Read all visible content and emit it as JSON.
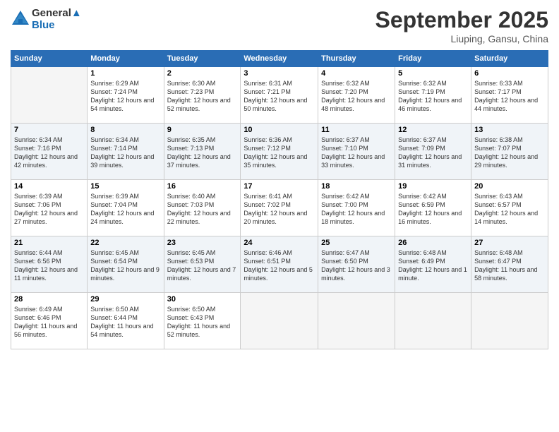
{
  "header": {
    "logo_line1": "General",
    "logo_line2": "Blue",
    "month": "September 2025",
    "location": "Liuping, Gansu, China"
  },
  "weekdays": [
    "Sunday",
    "Monday",
    "Tuesday",
    "Wednesday",
    "Thursday",
    "Friday",
    "Saturday"
  ],
  "weeks": [
    [
      {
        "day": "",
        "sunrise": "",
        "sunset": "",
        "daylight": ""
      },
      {
        "day": "1",
        "sunrise": "Sunrise: 6:29 AM",
        "sunset": "Sunset: 7:24 PM",
        "daylight": "Daylight: 12 hours and 54 minutes."
      },
      {
        "day": "2",
        "sunrise": "Sunrise: 6:30 AM",
        "sunset": "Sunset: 7:23 PM",
        "daylight": "Daylight: 12 hours and 52 minutes."
      },
      {
        "day": "3",
        "sunrise": "Sunrise: 6:31 AM",
        "sunset": "Sunset: 7:21 PM",
        "daylight": "Daylight: 12 hours and 50 minutes."
      },
      {
        "day": "4",
        "sunrise": "Sunrise: 6:32 AM",
        "sunset": "Sunset: 7:20 PM",
        "daylight": "Daylight: 12 hours and 48 minutes."
      },
      {
        "day": "5",
        "sunrise": "Sunrise: 6:32 AM",
        "sunset": "Sunset: 7:19 PM",
        "daylight": "Daylight: 12 hours and 46 minutes."
      },
      {
        "day": "6",
        "sunrise": "Sunrise: 6:33 AM",
        "sunset": "Sunset: 7:17 PM",
        "daylight": "Daylight: 12 hours and 44 minutes."
      }
    ],
    [
      {
        "day": "7",
        "sunrise": "Sunrise: 6:34 AM",
        "sunset": "Sunset: 7:16 PM",
        "daylight": "Daylight: 12 hours and 42 minutes."
      },
      {
        "day": "8",
        "sunrise": "Sunrise: 6:34 AM",
        "sunset": "Sunset: 7:14 PM",
        "daylight": "Daylight: 12 hours and 39 minutes."
      },
      {
        "day": "9",
        "sunrise": "Sunrise: 6:35 AM",
        "sunset": "Sunset: 7:13 PM",
        "daylight": "Daylight: 12 hours and 37 minutes."
      },
      {
        "day": "10",
        "sunrise": "Sunrise: 6:36 AM",
        "sunset": "Sunset: 7:12 PM",
        "daylight": "Daylight: 12 hours and 35 minutes."
      },
      {
        "day": "11",
        "sunrise": "Sunrise: 6:37 AM",
        "sunset": "Sunset: 7:10 PM",
        "daylight": "Daylight: 12 hours and 33 minutes."
      },
      {
        "day": "12",
        "sunrise": "Sunrise: 6:37 AM",
        "sunset": "Sunset: 7:09 PM",
        "daylight": "Daylight: 12 hours and 31 minutes."
      },
      {
        "day": "13",
        "sunrise": "Sunrise: 6:38 AM",
        "sunset": "Sunset: 7:07 PM",
        "daylight": "Daylight: 12 hours and 29 minutes."
      }
    ],
    [
      {
        "day": "14",
        "sunrise": "Sunrise: 6:39 AM",
        "sunset": "Sunset: 7:06 PM",
        "daylight": "Daylight: 12 hours and 27 minutes."
      },
      {
        "day": "15",
        "sunrise": "Sunrise: 6:39 AM",
        "sunset": "Sunset: 7:04 PM",
        "daylight": "Daylight: 12 hours and 24 minutes."
      },
      {
        "day": "16",
        "sunrise": "Sunrise: 6:40 AM",
        "sunset": "Sunset: 7:03 PM",
        "daylight": "Daylight: 12 hours and 22 minutes."
      },
      {
        "day": "17",
        "sunrise": "Sunrise: 6:41 AM",
        "sunset": "Sunset: 7:02 PM",
        "daylight": "Daylight: 12 hours and 20 minutes."
      },
      {
        "day": "18",
        "sunrise": "Sunrise: 6:42 AM",
        "sunset": "Sunset: 7:00 PM",
        "daylight": "Daylight: 12 hours and 18 minutes."
      },
      {
        "day": "19",
        "sunrise": "Sunrise: 6:42 AM",
        "sunset": "Sunset: 6:59 PM",
        "daylight": "Daylight: 12 hours and 16 minutes."
      },
      {
        "day": "20",
        "sunrise": "Sunrise: 6:43 AM",
        "sunset": "Sunset: 6:57 PM",
        "daylight": "Daylight: 12 hours and 14 minutes."
      }
    ],
    [
      {
        "day": "21",
        "sunrise": "Sunrise: 6:44 AM",
        "sunset": "Sunset: 6:56 PM",
        "daylight": "Daylight: 12 hours and 11 minutes."
      },
      {
        "day": "22",
        "sunrise": "Sunrise: 6:45 AM",
        "sunset": "Sunset: 6:54 PM",
        "daylight": "Daylight: 12 hours and 9 minutes."
      },
      {
        "day": "23",
        "sunrise": "Sunrise: 6:45 AM",
        "sunset": "Sunset: 6:53 PM",
        "daylight": "Daylight: 12 hours and 7 minutes."
      },
      {
        "day": "24",
        "sunrise": "Sunrise: 6:46 AM",
        "sunset": "Sunset: 6:51 PM",
        "daylight": "Daylight: 12 hours and 5 minutes."
      },
      {
        "day": "25",
        "sunrise": "Sunrise: 6:47 AM",
        "sunset": "Sunset: 6:50 PM",
        "daylight": "Daylight: 12 hours and 3 minutes."
      },
      {
        "day": "26",
        "sunrise": "Sunrise: 6:48 AM",
        "sunset": "Sunset: 6:49 PM",
        "daylight": "Daylight: 12 hours and 1 minute."
      },
      {
        "day": "27",
        "sunrise": "Sunrise: 6:48 AM",
        "sunset": "Sunset: 6:47 PM",
        "daylight": "Daylight: 11 hours and 58 minutes."
      }
    ],
    [
      {
        "day": "28",
        "sunrise": "Sunrise: 6:49 AM",
        "sunset": "Sunset: 6:46 PM",
        "daylight": "Daylight: 11 hours and 56 minutes."
      },
      {
        "day": "29",
        "sunrise": "Sunrise: 6:50 AM",
        "sunset": "Sunset: 6:44 PM",
        "daylight": "Daylight: 11 hours and 54 minutes."
      },
      {
        "day": "30",
        "sunrise": "Sunrise: 6:50 AM",
        "sunset": "Sunset: 6:43 PM",
        "daylight": "Daylight: 11 hours and 52 minutes."
      },
      {
        "day": "",
        "sunrise": "",
        "sunset": "",
        "daylight": ""
      },
      {
        "day": "",
        "sunrise": "",
        "sunset": "",
        "daylight": ""
      },
      {
        "day": "",
        "sunrise": "",
        "sunset": "",
        "daylight": ""
      },
      {
        "day": "",
        "sunrise": "",
        "sunset": "",
        "daylight": ""
      }
    ]
  ]
}
